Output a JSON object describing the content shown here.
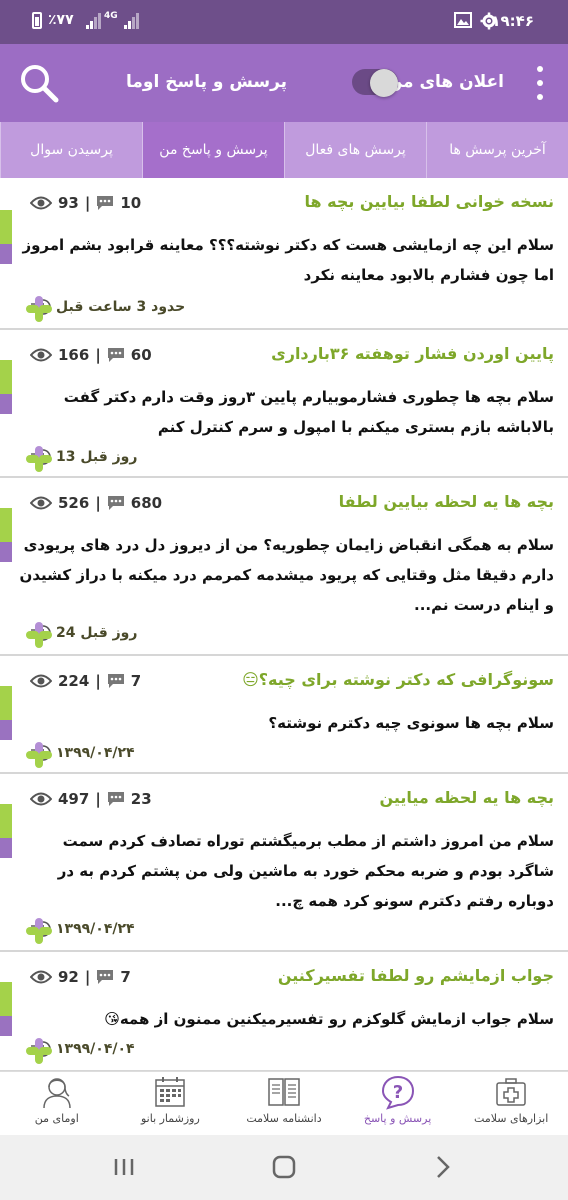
{
  "status_bar": {
    "time": "۱۹:۴۶",
    "battery": "٪۷۷",
    "network": "4G"
  },
  "app_bar": {
    "title": "پرسش و پاسخ اوما",
    "notifications_label": "اعلان های من",
    "notifications_enabled": false
  },
  "tabs": [
    {
      "label": "آخرین پرسش ها",
      "active": false
    },
    {
      "label": "پرسش های فعال",
      "active": false
    },
    {
      "label": "پرسش و پاسخ من",
      "active": true
    },
    {
      "label": "پرسیدن سوال",
      "active": false
    }
  ],
  "questions": [
    {
      "title": "نسخه خوانی لطفا بیایین بچه ها",
      "comments": "10",
      "views": "93",
      "body": "سلام این چه ازمایشی هست که دکتر نوشته؟؟؟ معاینه قرابود بشم امروز اما چون فشارم بالابود معاینه نکرد",
      "time": "حدود 3 ساعت قبل"
    },
    {
      "title": "پایین اوردن فشار توهفته ۳۶بارداری",
      "comments": "60",
      "views": "166",
      "body": "سلام بچه ها چطوری فشارموبیارم پایین ۳روز وقت دارم دکتر گفت بالاباشه بازم بستری میکنم با امپول و سرم کنترل کنم",
      "time": "13 روز قبل"
    },
    {
      "title": "بچه ها یه لحظه بیایین لطفا",
      "comments": "680",
      "views": "526",
      "body": "سلام به همگی انقباض زایمان چطوریه؟ من از دیروز دل درد های پریودی دارم دقیقا مثل وقتایی که پریود میشدمه  کمرمم درد میکنه  با دراز کشیدن و اینام درست نم...",
      "time": "24 روز قبل"
    },
    {
      "title": "سونوگرافی که دکتر نوشته برای چیه؟😑",
      "comments": "7",
      "views": "224",
      "body": "سلام بچه ها سونوی چیه دکترم نوشته؟",
      "time": "۱۳۹۹/۰۴/۲۴"
    },
    {
      "title": "بچه ها یه لحظه میایین",
      "comments": "23",
      "views": "497",
      "body": "سلام من امروز داشتم از مطب برمیگشتم توراه تصادف کردم سمت شاگرد بودم و ضربه محکم خورد به ماشین ولی من پشتم کردم به در  دوباره رفتم دکترم سونو کرد همه چ...",
      "time": "۱۳۹۹/۰۴/۲۴"
    },
    {
      "title": "جواب ازمایشم رو لطفا تفسیرکنین",
      "comments": "7",
      "views": "92",
      "body": "سلام جواب ازمایش گلوکزم رو تفسیرمیکنین ممنون از همه😘",
      "time": "۱۳۹۹/۰۴/۰۴"
    }
  ],
  "bottom_nav": [
    {
      "label": "ابزارهای سلامت",
      "icon": "health-tools-icon",
      "active": false
    },
    {
      "label": "پرسش و پاسخ",
      "icon": "question-icon",
      "active": true
    },
    {
      "label": "دانشنامه سلامت",
      "icon": "encyclopedia-icon",
      "active": false
    },
    {
      "label": "روزشمار بانو",
      "icon": "calendar-icon",
      "active": false
    },
    {
      "label": "اومای من",
      "icon": "profile-icon",
      "active": false
    }
  ],
  "colors": {
    "status_bar": "#6e4f8a",
    "app_bar": "#9c6dc4",
    "tab_bar": "#c09bdd",
    "tab_active": "#a56fcb",
    "title_green": "#7ea72a",
    "accent_green": "#a4d24a",
    "accent_purple": "#9a72c0"
  }
}
